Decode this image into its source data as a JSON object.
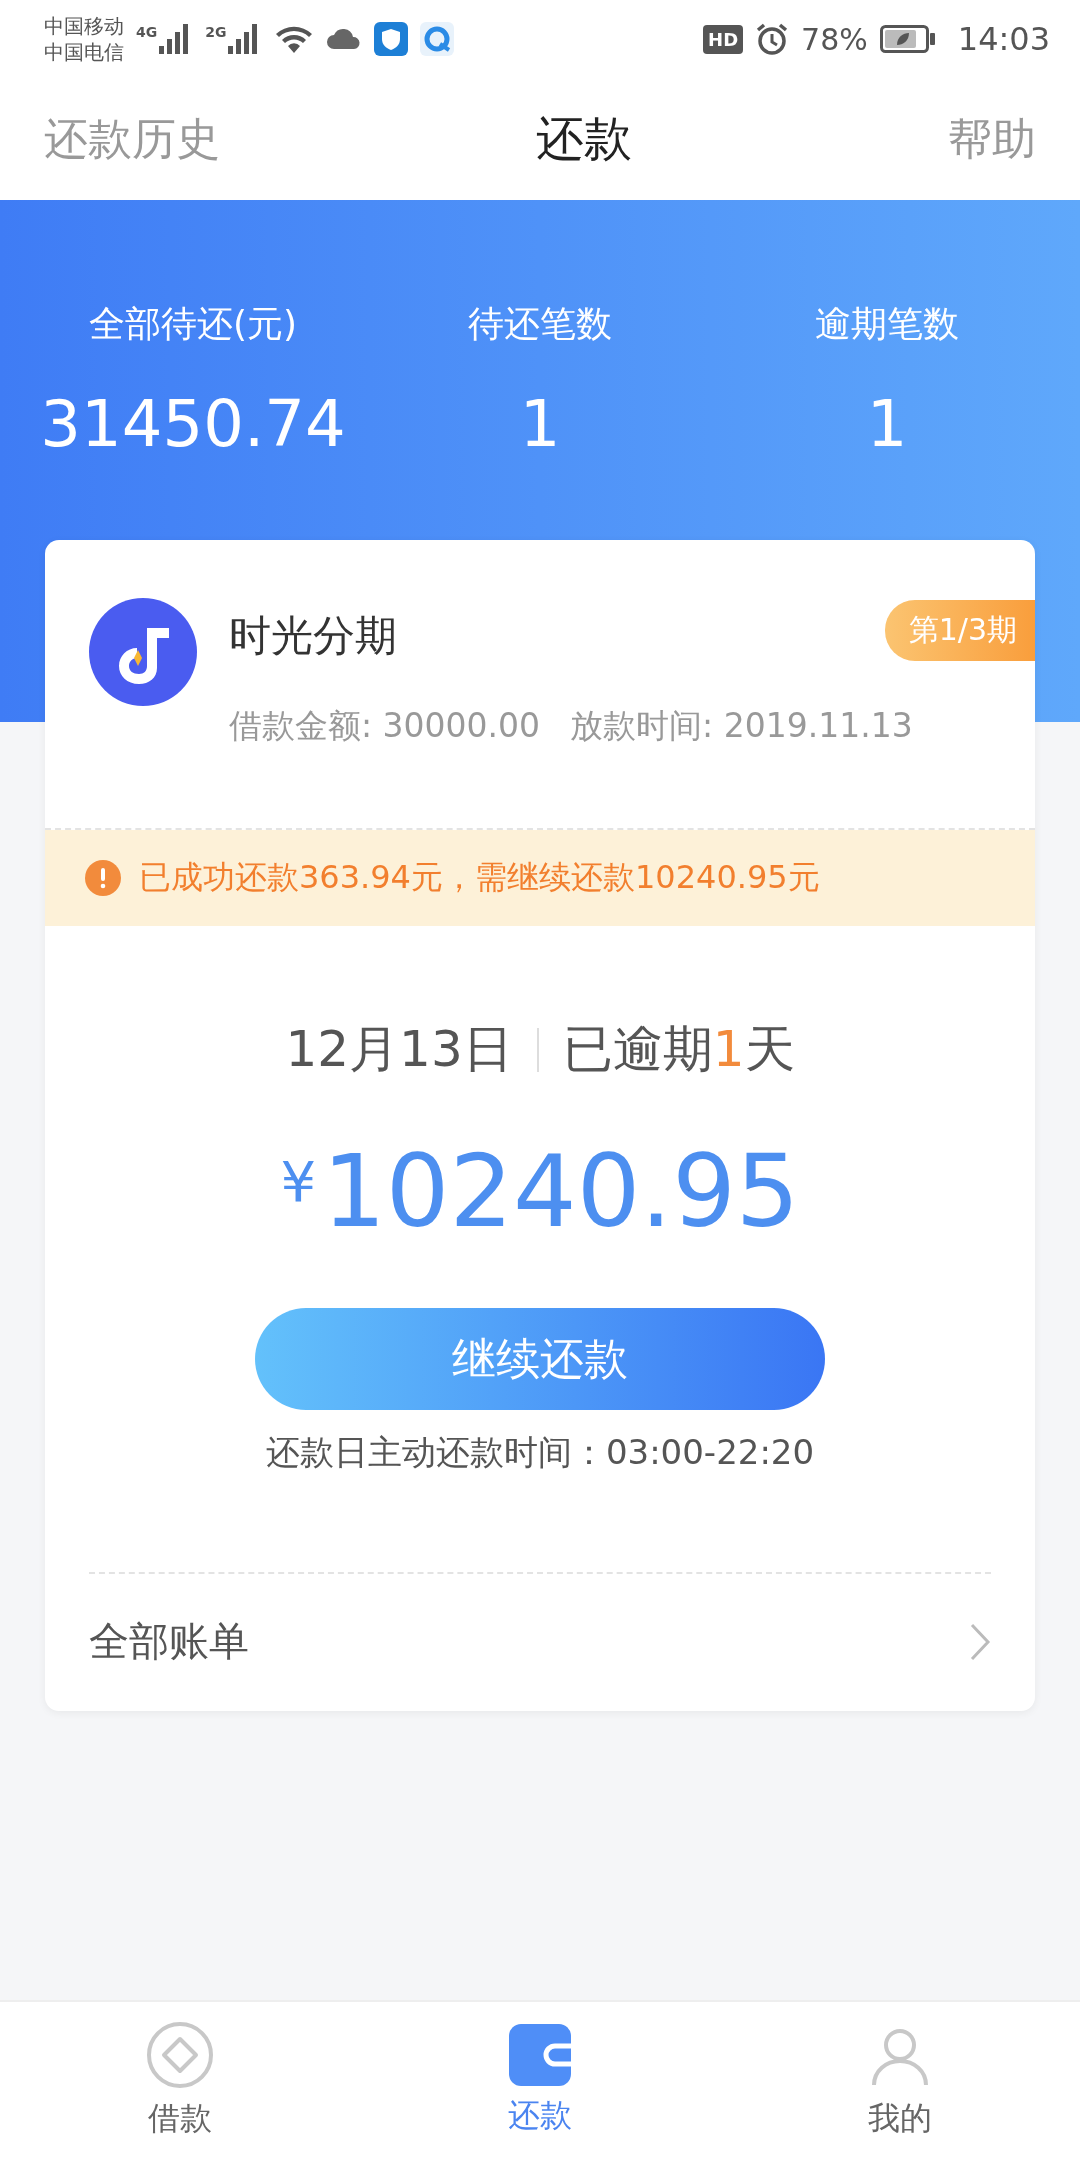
{
  "status_bar": {
    "carriers": [
      "中国移动",
      "中国电信"
    ],
    "networks": [
      "4G",
      "2G"
    ],
    "hd": "HD",
    "battery": "78%",
    "time": "14:03"
  },
  "header": {
    "left": "还款历史",
    "title": "还款",
    "right": "帮助"
  },
  "summary": [
    {
      "label": "全部待还(元)",
      "value": "31450.74"
    },
    {
      "label": "待还笔数",
      "value": "1"
    },
    {
      "label": "逾期笔数",
      "value": "1"
    }
  ],
  "loan": {
    "name": "时光分期",
    "installment": "第1/3期",
    "amount": "借款金额: 30000.00",
    "date": "放款时间: 2019.11.13"
  },
  "notice": "已成功还款363.94元，需继续还款10240.95元",
  "due": {
    "date": "12月13日",
    "overdue_before": "已逾期",
    "overdue_days": "1",
    "overdue_after": "天",
    "currency": "¥",
    "amount": "10240.95"
  },
  "pay_button": "继续还款",
  "hours": "还款日主动还款时间：03:00-22:20",
  "bills_link": "全部账单",
  "tabs": [
    {
      "label": "借款",
      "kind": "diamond",
      "selected": false
    },
    {
      "label": "还款",
      "kind": "wallet",
      "selected": true
    },
    {
      "label": "我的",
      "kind": "person",
      "selected": false
    }
  ]
}
